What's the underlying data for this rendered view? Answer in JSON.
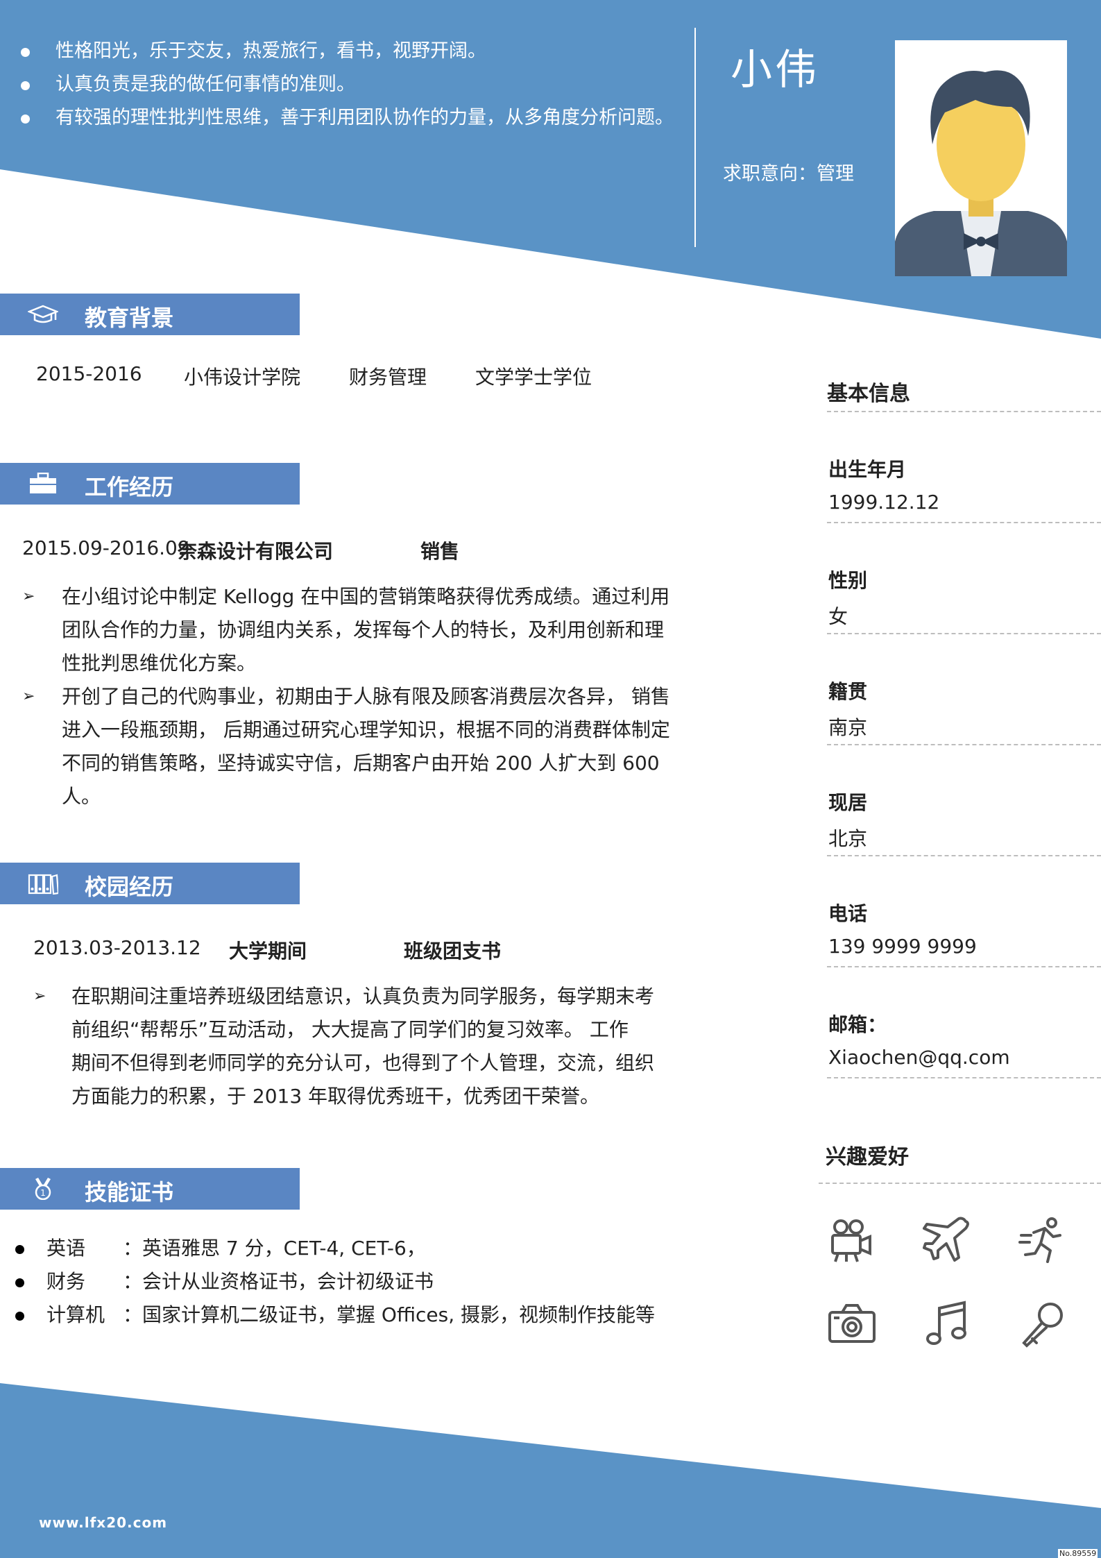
{
  "header": {
    "intro": [
      "性格阳光，乐于交友，热爱旅行，看书，视野开阔。",
      "认真负责是我的做任何事情的准则。",
      "有较强的理性批判性思维，善于利用团队协作的力量，从多角度分析问题。"
    ],
    "name": "小伟",
    "intent": "求职意向：管理"
  },
  "education": {
    "title": "教育背景",
    "period": "2015-2016",
    "school": "小伟设计学院",
    "major": "财务管理",
    "degree": "文学学士学位"
  },
  "work": {
    "title": "工作经历",
    "period": "2015.09-2016.09",
    "company": "奈森设计有限公司",
    "role": "销售",
    "bullets": [
      [
        "在小组讨论中制定 Kellogg 在中国的营销策略获得优秀成绩。通过利用",
        "团队合作的力量，协调组内关系，发挥每个人的特长，及利用创新和理",
        "性批判思维优化方案。"
      ],
      [
        "开创了自己的代购事业，初期由于人脉有限及顾客消费层次各异， 销售",
        "进入一段瓶颈期， 后期通过研究心理学知识，根据不同的消费群体制定",
        "不同的销售策略，坚持诚实守信，后期客户由开始 200 人扩大到 600 人。"
      ]
    ]
  },
  "campus": {
    "title": "校园经历",
    "period": "2013.03-2013.12",
    "org": "大学期间",
    "role": "班级团支书",
    "bullets": [
      [
        "在职期间注重培养班级团结意识，认真负责为同学服务，每学期末考",
        "前组织“帮帮乐”互动活动， 大大提高了同学们的复习效率。 工作",
        "期间不但得到老师同学的充分认可，也得到了个人管理，交流，组织",
        "方面能力的积累，于 2013 年取得优秀班干，优秀团干荣誉。"
      ]
    ]
  },
  "skills": {
    "title": "技能证书",
    "items": [
      {
        "label": "英语",
        "text": "：英语雅思 7 分，CET-4, CET-6，"
      },
      {
        "label": "财务",
        "text": "：会计从业资格证书，会计初级证书"
      },
      {
        "label": "计算机",
        "text": "：国家计算机二级证书，掌握 Offices, 摄影，视频制作技能等"
      }
    ]
  },
  "basic_info": {
    "title": "基本信息",
    "fields": [
      {
        "label": "出生年月",
        "value": "1999.12.12"
      },
      {
        "label": "性别",
        "value": "女"
      },
      {
        "label": "籍贯",
        "value": "南京"
      },
      {
        "label": "现居",
        "value": "北京"
      },
      {
        "label": "电话",
        "value": "139 9999 9999"
      },
      {
        "label": "邮箱：",
        "value": "Xiaochen@qq.com"
      }
    ]
  },
  "hobbies": {
    "title": "兴趣爱好",
    "icons": [
      "movie-camera-icon",
      "airplane-icon",
      "running-icon",
      "camera-icon",
      "music-note-icon",
      "microphone-icon"
    ]
  },
  "footer": {
    "url": "www.lfx20.com",
    "doc_no": "No.89559"
  },
  "colors": {
    "primary": "#5a93c6",
    "section_bar": "#5a86c3",
    "icon_gray": "#555555"
  }
}
